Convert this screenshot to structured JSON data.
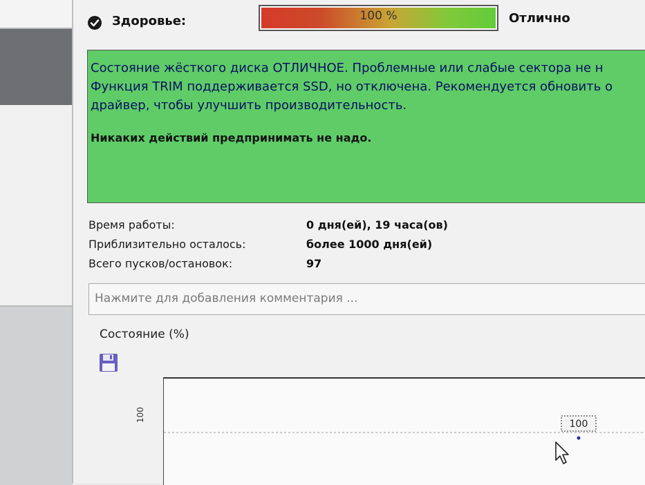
{
  "health": {
    "label": "Здоровье:",
    "percent_text": "100 %",
    "percent": 100,
    "status": "Отлично"
  },
  "message": {
    "text": "Состояние жёсткого диска ОТЛИЧНОЕ. Проблемные или слабые сектора не н\nФункция TRIM поддерживается SSD, но отключена. Рекомендуется обновить о\nдрайвер, чтобы улучшить производительность.",
    "bold_text": "Никаких действий предпринимать не надо."
  },
  "info": {
    "uptime_label": "Время работы:",
    "uptime_value": "0 дня(ей), 19 часа(ов)",
    "remaining_label": "Приблизительно осталось:",
    "remaining_value": "более 1000 дня(ей)",
    "starts_label": "Всего пусков/остановок:",
    "starts_value": "97"
  },
  "comment": {
    "placeholder": "Нажмите для добавления комментария ..."
  },
  "chart": {
    "title": "Состояние (%)",
    "save_icon": "save-icon"
  },
  "chart_data": {
    "type": "line",
    "title": "Состояние (%)",
    "y_tick_labels": [
      "100"
    ],
    "series": [
      {
        "values": [
          100
        ],
        "point_labels": [
          "100"
        ]
      }
    ],
    "grid": true
  },
  "colors": {
    "message_bg": "#5fcc68",
    "health_low": "#d63a2a",
    "health_high": "#62cc3a"
  }
}
